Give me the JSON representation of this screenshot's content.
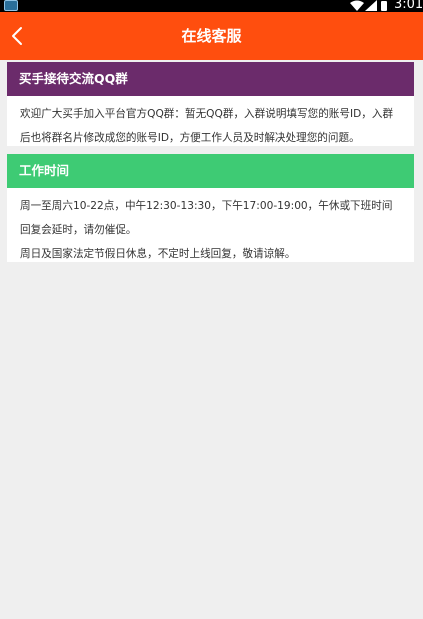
{
  "status_bar": {
    "time": "3:01",
    "icons": [
      "app-icon",
      "wifi-icon",
      "signal-icon",
      "battery-icon"
    ]
  },
  "header": {
    "title": "在线客服",
    "back_icon": "chevron-left-icon",
    "background": "#ff4e0e"
  },
  "cards": [
    {
      "title": "买手接待交流QQ群",
      "color": "#6b2b6b",
      "paragraphs": [
        "欢迎广大买手加入平台官方QQ群：暂无QQ群，入群说明填写您的账号ID，入群后也将群名片修改成您的账号ID，方便工作人员及时解决处理您的问题。"
      ]
    },
    {
      "title": "工作时间",
      "color": "#3ecb74",
      "paragraphs": [
        "周一至周六10-22点，中午12:30-13:30，下午17:00-19:00，午休或下班时间回复会延时，请勿催促。",
        "周日及国家法定节假日休息，不定时上线回复，敬请谅解。"
      ]
    }
  ]
}
